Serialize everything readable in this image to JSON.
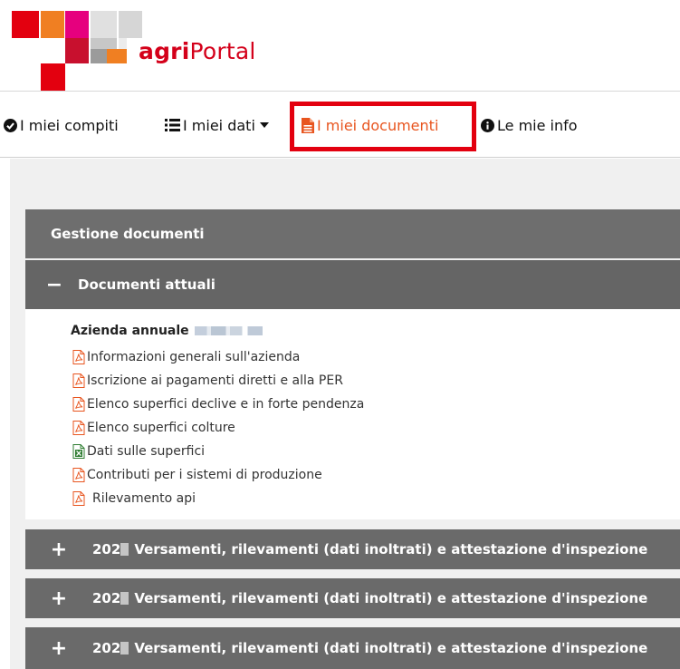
{
  "brand": {
    "prefix": "agri",
    "suffix": "Portal"
  },
  "nav": {
    "items": [
      {
        "label": "I miei compiti",
        "icon": "check-circle-icon"
      },
      {
        "label": "I miei dati",
        "icon": "list-icon",
        "has_dropdown": true
      },
      {
        "label": "I miei documenti",
        "icon": "document-icon",
        "active": true
      },
      {
        "label": "Le mie info",
        "icon": "info-circle-icon"
      }
    ]
  },
  "colors": {
    "accent": "#e8551f",
    "highlight": "#e3000f",
    "brand_red": "#d4001a",
    "bar": "#6a6a6a"
  },
  "documents": {
    "section_title": "Gestione documenti",
    "current": {
      "label": "Documenti attuali",
      "toggle": "−",
      "company_label": "Azienda annuale",
      "files": [
        {
          "name": "Informazioni generali sull'azienda",
          "type": "pdf"
        },
        {
          "name": "Iscrizione ai pagamenti diretti e alla PER",
          "type": "pdf"
        },
        {
          "name": "Elenco superfici declive e in forte pendenza",
          "type": "pdf"
        },
        {
          "name": "Elenco superfici colture",
          "type": "pdf"
        },
        {
          "name": "Dati sulle superfici",
          "type": "excel"
        },
        {
          "name": "Contributi per i sistemi di produzione",
          "type": "pdf"
        },
        {
          "name": "Rilevamento api",
          "type": "pdf"
        }
      ]
    },
    "archive": [
      {
        "year_prefix": "202",
        "label": "Versamenti, rilevamenti (dati inoltrati) e attestazione d'inspezione",
        "toggle": "+"
      },
      {
        "year_prefix": "202",
        "label": "Versamenti, rilevamenti (dati inoltrati) e attestazione d'inspezione",
        "toggle": "+"
      },
      {
        "year_prefix": "202",
        "label": "Versamenti, rilevamenti (dati inoltrati) e attestazione d'inspezione",
        "toggle": "+"
      }
    ]
  }
}
